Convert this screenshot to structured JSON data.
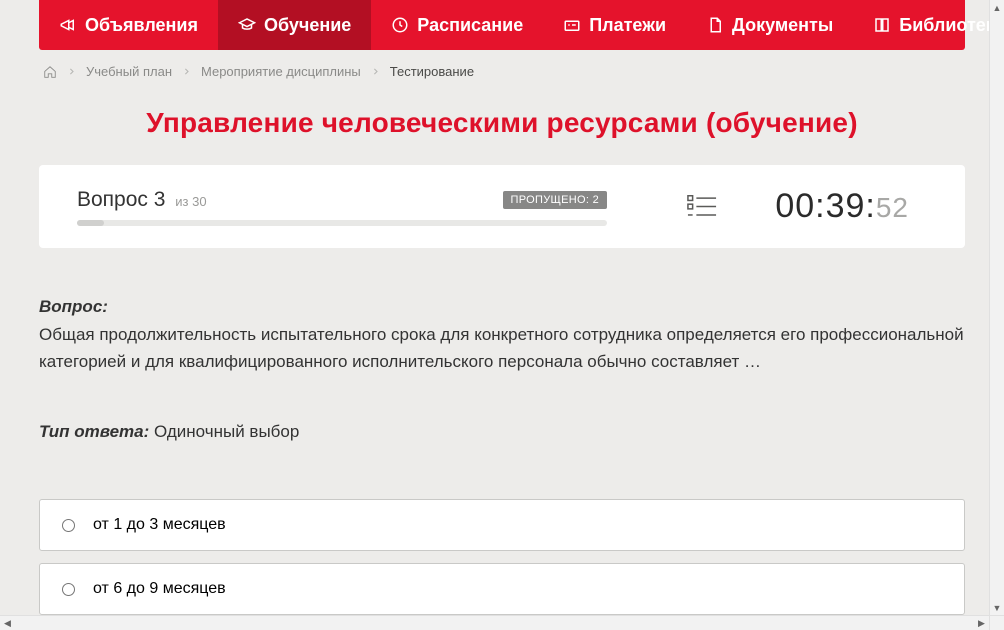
{
  "nav": {
    "items": [
      {
        "label": "Объявления",
        "active": false
      },
      {
        "label": "Обучение",
        "active": true
      },
      {
        "label": "Расписание",
        "active": false
      },
      {
        "label": "Платежи",
        "active": false
      },
      {
        "label": "Документы",
        "active": false
      },
      {
        "label": "Библиотека",
        "active": false,
        "has_submenu": true
      }
    ]
  },
  "breadcrumbs": {
    "items": [
      {
        "label": "Учебный план"
      },
      {
        "label": "Мероприятие дисциплины"
      }
    ],
    "current": "Тестирование"
  },
  "page_title": "Управление человеческими ресурсами (обучение)",
  "status": {
    "question_label": "Вопрос",
    "question_number": "3",
    "question_of_prefix": "из",
    "question_total": "30",
    "skipped_label": "ПРОПУЩЕНО:",
    "skipped_count": "2",
    "timer_main": "00:39:",
    "timer_seconds": "52"
  },
  "question": {
    "label": "Вопрос:",
    "text": "Общая продолжительность испытательного срока для конкретного сотрудника определяется его профессиональной категорией и для квалифицированного исполнительского персонала обычно составляет …",
    "answer_type_label": "Тип ответа:",
    "answer_type_value": "Одиночный выбор"
  },
  "options": [
    {
      "label": "от 1 до 3 месяцев"
    },
    {
      "label": "от 6 до 9 месяцев"
    }
  ]
}
